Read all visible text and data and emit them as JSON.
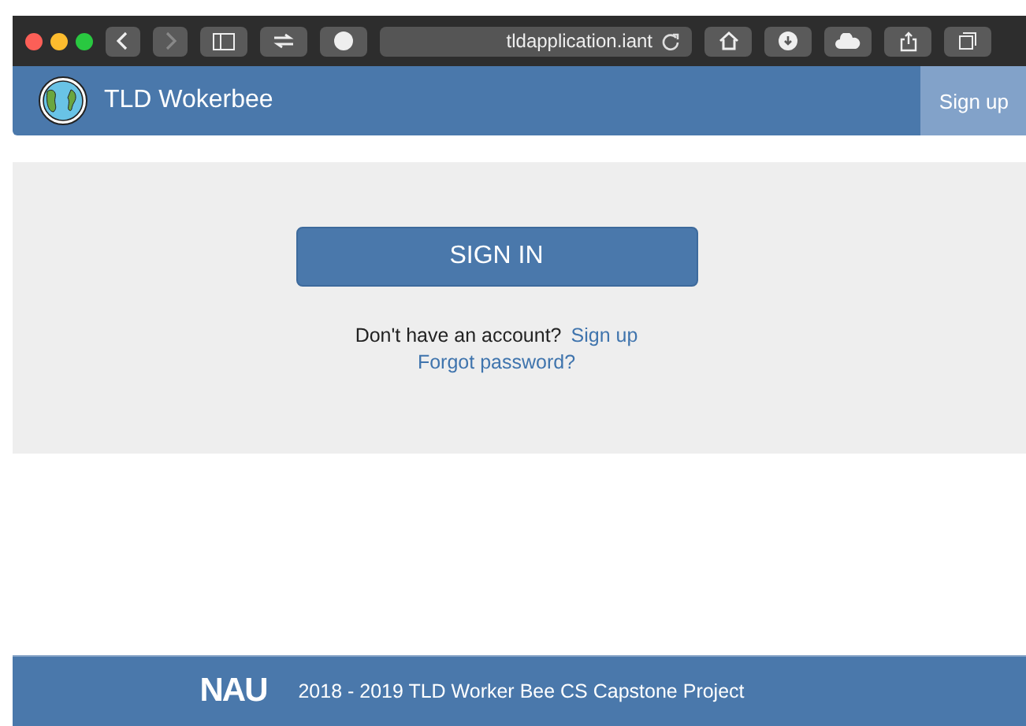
{
  "browser": {
    "url": "tldapplication.iant"
  },
  "navbar": {
    "brand": "TLD Wokerbee",
    "link": "Sign up"
  },
  "signin": {
    "button": "SIGN IN",
    "prompt": "Don't have an account?",
    "signup_link": "Sign up",
    "forgot_link": "Forgot password?"
  },
  "footer": {
    "logo": "NAU",
    "text": "2018 - 2019 TLD Worker Bee CS Capstone Project"
  }
}
